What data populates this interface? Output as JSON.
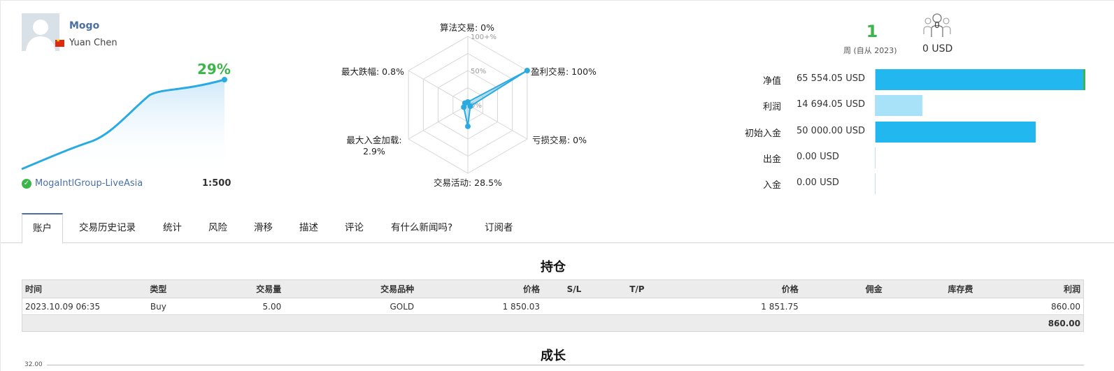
{
  "profile": {
    "name": "Mogo",
    "real_name": "Yuan Chen",
    "growth_pct": "29%",
    "broker": "MogaIntlGroup-LiveAsia",
    "leverage": "1:500",
    "country_flag": "CN",
    "accent": "#3cb54a",
    "line_color": "#29abe2"
  },
  "radar": {
    "labels": {
      "algo": "算法交易: 0%",
      "profit_trades": "盈利交易: 100%",
      "loss_trades": "亏损交易: 0%",
      "activity": "交易活动: 28.5%",
      "max_deposit_load_title": "最大入金加载:",
      "max_deposit_load_value": "2.9%",
      "max_drawdown": "最大跌幅: 0.8%"
    },
    "scale_labels": {
      "max": "100+%",
      "mid": "50%",
      "min": "0%"
    },
    "values": {
      "algo": 0,
      "profit_trades": 100,
      "loss_trades": 0,
      "activity": 28.5,
      "max_deposit_load": 2.9,
      "max_drawdown": 0.8
    }
  },
  "summary": {
    "weeks": "1",
    "weeks_label": "周 (自从 2023)",
    "subscribers": "0",
    "subscription_price": "0 USD"
  },
  "stats": [
    {
      "label": "净值",
      "value": "65 554.05 USD",
      "fraction": 1.0,
      "color": "#22b7ef"
    },
    {
      "label": "利润",
      "value": "14 694.05 USD",
      "fraction": 0.224,
      "color": "#a8e2f8"
    },
    {
      "label": "初始入金",
      "value": "50 000.00 USD",
      "fraction": 0.763,
      "color": "#22b7ef"
    },
    {
      "label": "出金",
      "value": "0.00 USD",
      "fraction": 0,
      "color": "#22b7ef"
    },
    {
      "label": "入金",
      "value": "0.00 USD",
      "fraction": 0,
      "color": "#22b7ef"
    }
  ],
  "tabs": [
    "账户",
    "交易历史记录",
    "统计",
    "风险",
    "滑移",
    "描述",
    "评论",
    "有什么新闻吗?",
    "订阅者"
  ],
  "positions": {
    "title": "持仓",
    "headers": [
      "时间",
      "类型",
      "交易量",
      "交易品种",
      "价格",
      "S/L",
      "T/P",
      "价格",
      "佣金",
      "库存费",
      "利润"
    ],
    "rows": [
      [
        "2023.10.09 06:35",
        "Buy",
        "5.00",
        "GOLD",
        "1 850.03",
        "",
        "",
        "1 851.75",
        "",
        "",
        "860.00"
      ]
    ],
    "total": "860.00"
  },
  "growth": {
    "title": "成长",
    "y_tick": "32.00"
  }
}
